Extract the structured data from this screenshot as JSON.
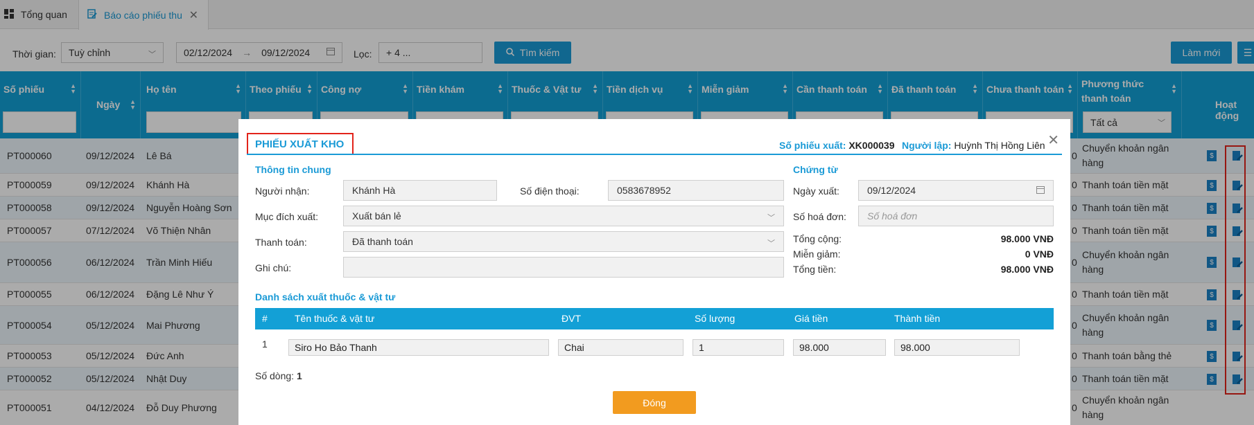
{
  "tabs": [
    {
      "label": "Tổng quan",
      "icon": "dashboard-icon"
    },
    {
      "label": "Báo cáo phiếu thu",
      "icon": "edit-document-icon"
    }
  ],
  "filter": {
    "time_label": "Thời gian:",
    "time_value": "Tuỳ chỉnh",
    "date_from": "02/12/2024",
    "date_arrow": "→",
    "date_to": "09/12/2024",
    "loc_label": "Lọc:",
    "loc_value": "+ 4 ...",
    "search_label": "Tìm kiếm",
    "refresh_label": "Làm mới"
  },
  "table": {
    "columns": [
      "Số phiếu",
      "Ngày",
      "Họ tên",
      "Theo phiếu",
      "Công nợ",
      "Tiền khám",
      "Thuốc & Vật tư",
      "Tiền dịch vụ",
      "Miễn giảm",
      "Cần thanh toán",
      "Đã thanh toán",
      "Chưa thanh toán",
      "Phương thức thanh toán",
      "Hoạt động"
    ],
    "payment_filter": "Tất cả",
    "rows": [
      {
        "id": "PT000060",
        "date": "09/12/2024",
        "name": "Lê Bá",
        "pay": "Chuyển khoản ngân hàng",
        "edge": "0"
      },
      {
        "id": "PT000059",
        "date": "09/12/2024",
        "name": "Khánh Hà",
        "pay": "Thanh toán tiền mặt",
        "edge": "0"
      },
      {
        "id": "PT000058",
        "date": "09/12/2024",
        "name": "Nguyễn Hoàng Sơn",
        "pay": "Thanh toán tiền mặt",
        "edge": "0"
      },
      {
        "id": "PT000057",
        "date": "07/12/2024",
        "name": "Võ Thiện Nhân",
        "pay": "Thanh toán tiền mặt",
        "edge": "0"
      },
      {
        "id": "PT000056",
        "date": "06/12/2024",
        "name": "Trần Minh Hiếu",
        "pay": "Chuyển khoản ngân hàng",
        "edge": "0"
      },
      {
        "id": "PT000055",
        "date": "06/12/2024",
        "name": "Đặng Lê Như Ý",
        "pay": "Thanh toán tiền mặt",
        "edge": "0"
      },
      {
        "id": "PT000054",
        "date": "05/12/2024",
        "name": "Mai Phương",
        "pay": "Chuyển khoản ngân hàng",
        "edge": "0"
      },
      {
        "id": "PT000053",
        "date": "05/12/2024",
        "name": "Đức Anh",
        "pay": "Thanh toán bằng thẻ",
        "edge": "0"
      },
      {
        "id": "PT000052",
        "date": "05/12/2024",
        "name": "Nhật Duy",
        "pay": "Thanh toán tiền mặt",
        "edge": "0"
      },
      {
        "id": "PT000051",
        "date": "04/12/2024",
        "name": "Đỗ Duy Phương",
        "pay": "Chuyển khoản ngân hàng",
        "edge": "0"
      }
    ]
  },
  "modal": {
    "title": "PHIẾU XUẤT KHO",
    "so_phieu_label": "Số phiếu xuất:",
    "so_phieu_value": "XK000039",
    "nguoi_lap_label": "Người lập:",
    "nguoi_lap_value": "Huỳnh Thị Hồng Liên",
    "general_title": "Thông tin chung",
    "nguoi_nhan_label": "Người nhận:",
    "nguoi_nhan_value": "Khánh Hà",
    "sdt_label": "Số điện thoại:",
    "sdt_value": "0583678952",
    "muc_dich_label": "Mục đích xuất:",
    "muc_dich_value": "Xuất bán lẻ",
    "thanh_toan_label": "Thanh toán:",
    "thanh_toan_value": "Đã thanh toán",
    "ghi_chu_label": "Ghi chú:",
    "ghi_chu_value": "",
    "chung_tu_title": "Chứng từ",
    "ngay_xuat_label": "Ngày xuất:",
    "ngay_xuat_value": "09/12/2024",
    "so_hoa_don_label": "Số hoá đơn:",
    "so_hoa_don_placeholder": "Số hoá đơn",
    "tong_cong_label": "Tổng cộng:",
    "tong_cong_value": "98.000 VNĐ",
    "mien_giam_label": "Miễn giảm:",
    "mien_giam_value": "0 VNĐ",
    "tong_tien_label": "Tổng tiền:",
    "tong_tien_value": "98.000 VNĐ",
    "list_title": "Danh sách xuất thuốc & vật tư",
    "list_columns": [
      "#",
      "Tên thuốc & vật tư",
      "ĐVT",
      "Số lượng",
      "Giá tiền",
      "Thành tiền"
    ],
    "items": [
      {
        "no": "1",
        "name": "Siro Ho Bảo Thanh",
        "unit": "Chai",
        "qty": "1",
        "price": "98.000",
        "total": "98.000"
      }
    ],
    "row_count_label": "Số dòng:",
    "row_count_value": "1",
    "close_button": "Đóng"
  },
  "colors": {
    "primary": "#13a0d6",
    "highlight": "#e2231a",
    "accent_button": "#f29b1f"
  }
}
